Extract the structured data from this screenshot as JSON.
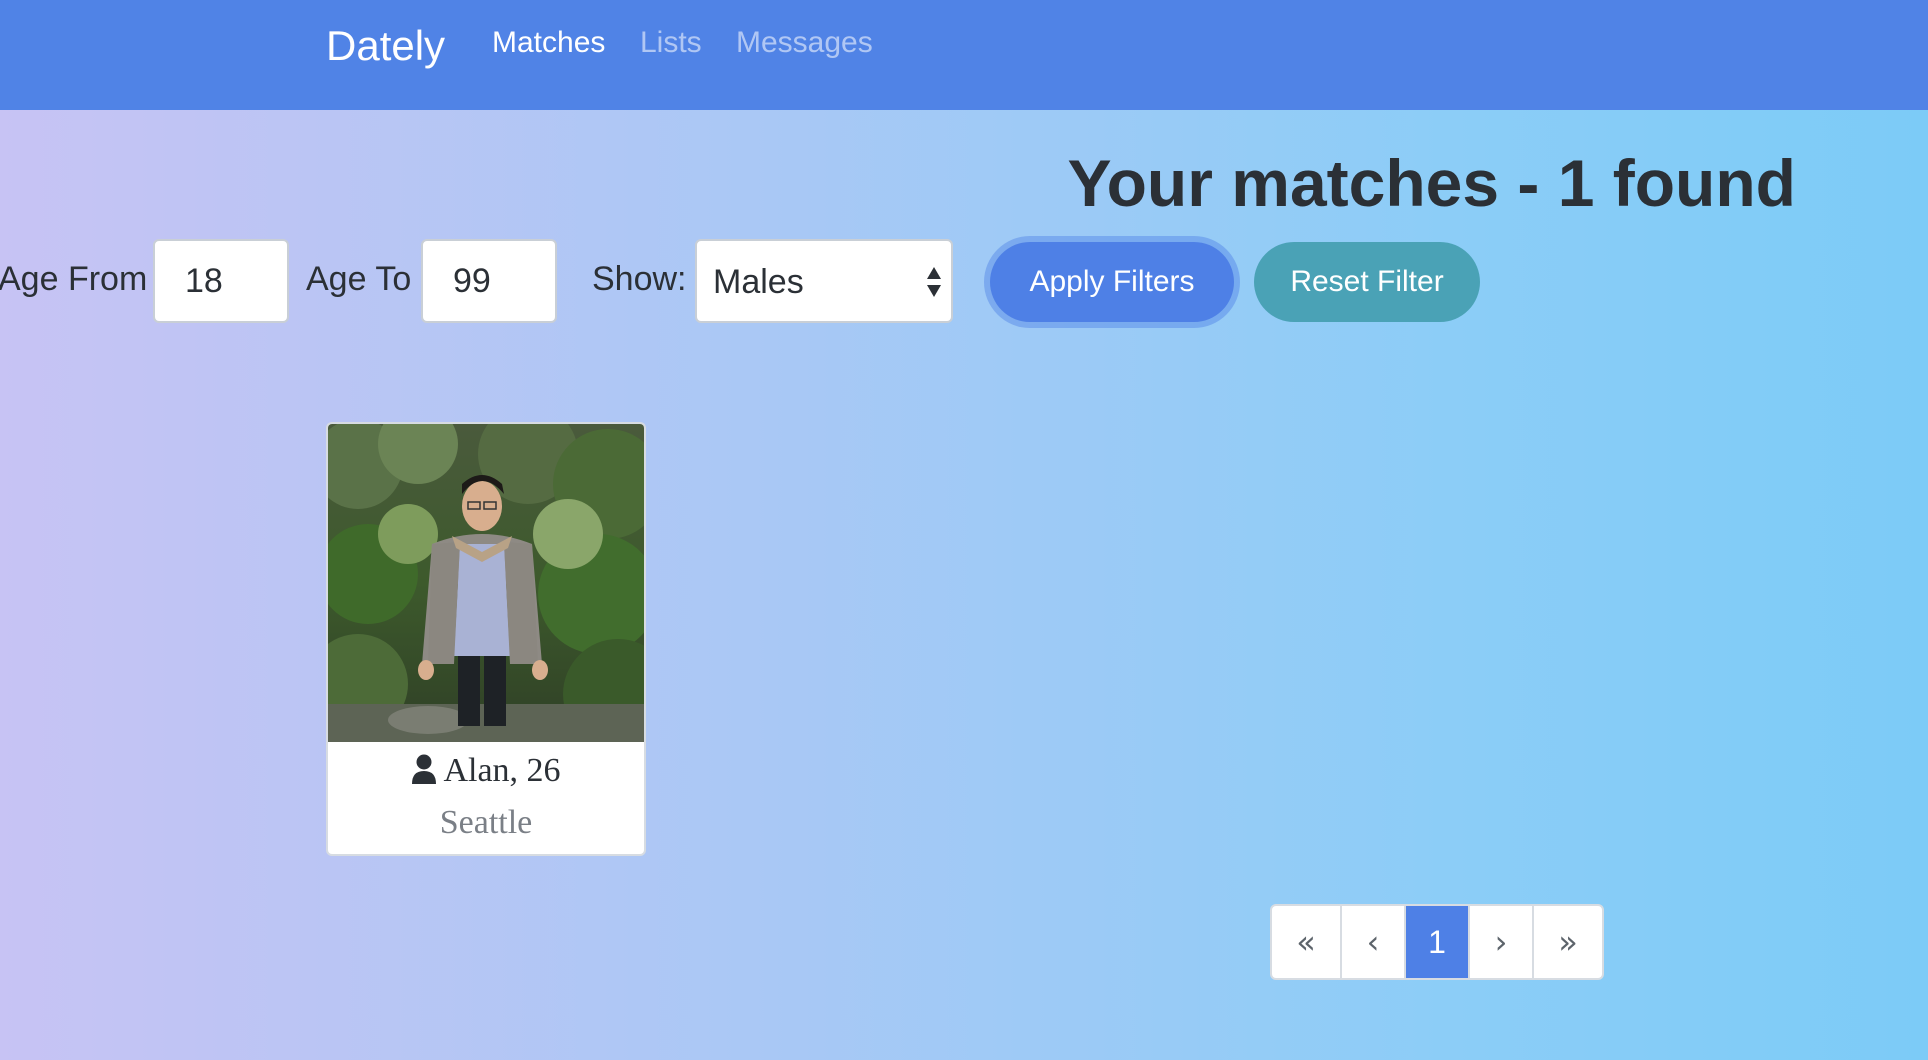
{
  "navbar": {
    "brand": "Dately",
    "links": [
      {
        "label": "Matches",
        "active": true
      },
      {
        "label": "Lists",
        "active": false
      },
      {
        "label": "Messages",
        "active": false
      }
    ],
    "background_color": "#5083e6"
  },
  "main": {
    "title": "Your matches - 1 found"
  },
  "filters": {
    "age_from_label": "Age From",
    "age_from_value": "18",
    "age_to_label": "Age To",
    "age_to_value": "99",
    "show_label": "Show:",
    "show_value": "Males",
    "apply_label": "Apply Filters",
    "reset_label": "Reset Filter",
    "apply_color": "#4e80e6",
    "reset_color": "#4aa2b6"
  },
  "matches": [
    {
      "name_age": "Alan, 26",
      "city": "Seattle",
      "icon": "user-icon"
    }
  ],
  "pagination": {
    "first": "«",
    "prev": "‹",
    "current": "1",
    "next": "›",
    "last": "»"
  }
}
